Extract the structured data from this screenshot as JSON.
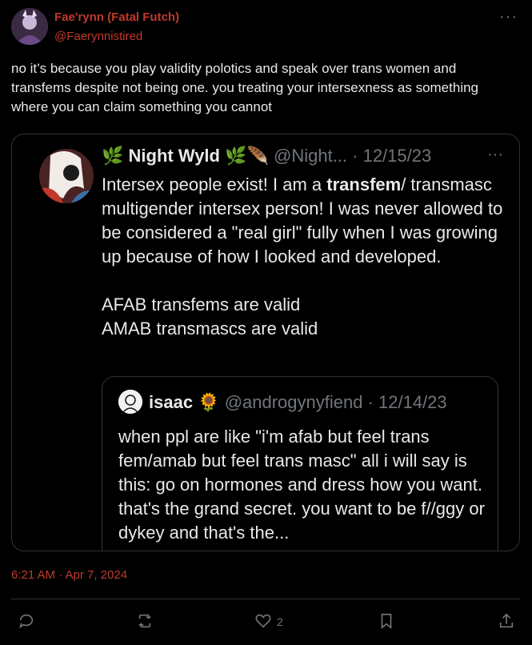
{
  "tweet": {
    "display_name": "Fae'rynn (Fatal Futch)",
    "handle": "@Faerynnistired",
    "text": "no it’s because you play validity polotics and speak over trans women and transfems despite not being one. you treating your intersexness as something where you can claim something you cannot",
    "timestamp": "6:21 AM · Apr 7, 2024",
    "likes": "2"
  },
  "quote": {
    "display_name": "🌿 Night Wyld 🌿🪶",
    "meta": "@Night... · 12/15/23",
    "text_pre": "Intersex people exist! I am a ",
    "text_bold": "transfem",
    "text_post": "/ transmasc multigender intersex person! I was never allowed to be considered a \"real girl\" fully when I was growing up because of how I looked and developed.",
    "line2": "AFAB transfems are valid",
    "line3": "AMAB transmascs are valid"
  },
  "inner_quote": {
    "display_name": "isaac 🌻",
    "meta": "@androgynyfiend · 12/14/23",
    "text": "when ppl are like \"i'm afab but feel trans fem/amab but feel trans masc\" all i will say is this: go on hormones and dress how you want. that's the grand secret. you want to be f//ggy or dykey and that's the..."
  },
  "colors": {
    "accent_red": "#c0392b",
    "muted": "#71767b",
    "border": "#2f3336",
    "text": "#e7e9ea"
  },
  "icons": {
    "more": "more-icon",
    "reply": "reply-icon",
    "retweet": "retweet-icon",
    "like": "heart-icon",
    "bookmark": "bookmark-icon",
    "share": "share-icon"
  }
}
